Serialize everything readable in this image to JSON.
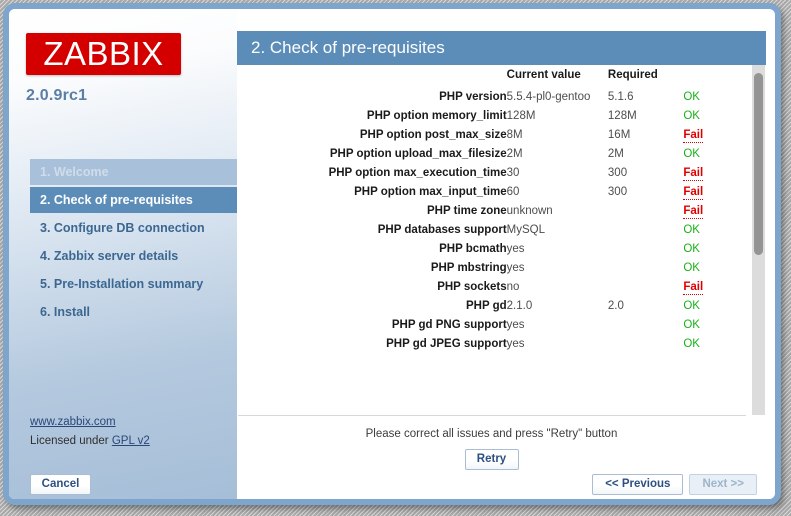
{
  "branding": {
    "logo_text": "ZABBIX",
    "logo_color": "#d40000",
    "version": "2.0.9rc1"
  },
  "sidebar": {
    "steps": [
      {
        "label": "1. Welcome",
        "state": "done"
      },
      {
        "label": "2. Check of pre-requisites",
        "state": "active"
      },
      {
        "label": "3. Configure DB connection",
        "state": "pending"
      },
      {
        "label": "4. Zabbix server details",
        "state": "pending"
      },
      {
        "label": "5. Pre-Installation summary",
        "state": "pending"
      },
      {
        "label": "6. Install",
        "state": "pending"
      }
    ],
    "website_link": "www.zabbix.com",
    "license_prefix": "Licensed under ",
    "license_link": "GPL v2",
    "cancel_label": "Cancel"
  },
  "panel": {
    "title": "2. Check of pre-requisites",
    "columns": {
      "name": "",
      "current": "Current value",
      "required": "Required",
      "status": ""
    },
    "rows": [
      {
        "name": "PHP version",
        "current": "5.5.4-pl0-gentoo",
        "required": "5.1.6",
        "status": "OK",
        "fail": false
      },
      {
        "name": "PHP option memory_limit",
        "current": "128M",
        "required": "128M",
        "status": "OK",
        "fail": false
      },
      {
        "name": "PHP option post_max_size",
        "current": "8M",
        "required": "16M",
        "status": "Fail",
        "fail": true
      },
      {
        "name": "PHP option upload_max_filesize",
        "current": "2M",
        "required": "2M",
        "status": "OK",
        "fail": false
      },
      {
        "name": "PHP option max_execution_time",
        "current": "30",
        "required": "300",
        "status": "Fail",
        "fail": true
      },
      {
        "name": "PHP option max_input_time",
        "current": "60",
        "required": "300",
        "status": "Fail",
        "fail": true
      },
      {
        "name": "PHP time zone",
        "current": "unknown",
        "required": "",
        "status": "Fail",
        "fail": true
      },
      {
        "name": "PHP databases support",
        "current": "MySQL",
        "required": "",
        "status": "OK",
        "fail": false
      },
      {
        "name": "PHP bcmath",
        "current": "yes",
        "required": "",
        "status": "OK",
        "fail": false
      },
      {
        "name": "PHP mbstring",
        "current": "yes",
        "required": "",
        "status": "OK",
        "fail": false
      },
      {
        "name": "PHP sockets",
        "current": "no",
        "required": "",
        "status": "Fail",
        "fail": true
      },
      {
        "name": "PHP gd",
        "current": "2.1.0",
        "required": "2.0",
        "status": "OK",
        "fail": false
      },
      {
        "name": "PHP gd PNG support",
        "current": "yes",
        "required": "",
        "status": "OK",
        "fail": false
      },
      {
        "name": "PHP gd JPEG support",
        "current": "yes",
        "required": "",
        "status": "OK",
        "fail": false
      }
    ],
    "retry_message": "Please correct all issues and press \"Retry\" button",
    "retry_label": "Retry"
  },
  "nav": {
    "previous_label": "<< Previous",
    "next_label": "Next >>",
    "next_disabled": true
  },
  "colors": {
    "accent_blue": "#5b8db8",
    "ok_green": "#19b219",
    "fail_red": "#e00000",
    "brand_red": "#d40000"
  }
}
